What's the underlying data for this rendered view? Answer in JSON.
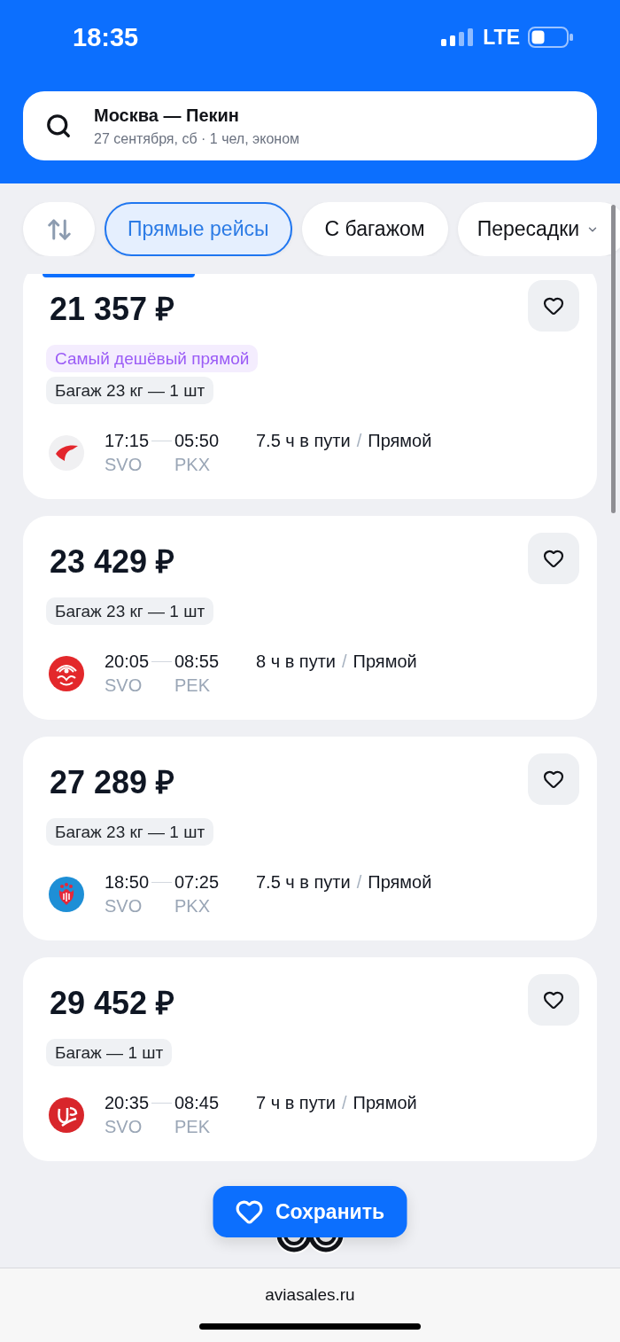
{
  "status_bar": {
    "time": "18:35",
    "network": "LTE"
  },
  "search": {
    "route": "Москва — Пекин",
    "details": "27 сентября, сб · 1 чел, эконом"
  },
  "filters": [
    {
      "kind": "sort",
      "selected": false
    },
    {
      "kind": "chip",
      "label": "Прямые рейсы",
      "selected": true
    },
    {
      "kind": "chip",
      "label": "С багажом",
      "selected": false
    },
    {
      "kind": "dropdown",
      "label": "Пересадки",
      "selected": false
    }
  ],
  "results": [
    {
      "top_tag": true,
      "price": "21 357 ₽",
      "saved": false,
      "badges": [
        {
          "kind": "highlight",
          "text": "Самый дешёвый прямой"
        },
        {
          "kind": "baggage",
          "text": "Багаж 23 кг — 1 шт"
        }
      ],
      "flight": {
        "departure_time": "17:15",
        "arrival_time": "05:50",
        "origin": "SVO",
        "destination": "PKX",
        "duration": "7.5 ч в пути",
        "separator": "/",
        "stops": "Прямой"
      }
    },
    {
      "top_tag": false,
      "price": "23 429 ₽",
      "saved": false,
      "badges": [
        {
          "kind": "baggage",
          "text": "Багаж 23 кг — 1 шт"
        }
      ],
      "flight": {
        "departure_time": "20:05",
        "arrival_time": "08:55",
        "origin": "SVO",
        "destination": "PEK",
        "duration": "8 ч в пути",
        "separator": "/",
        "stops": "Прямой"
      }
    },
    {
      "top_tag": false,
      "price": "27 289 ₽",
      "saved": false,
      "badges": [
        {
          "kind": "baggage",
          "text": "Багаж 23 кг — 1 шт"
        }
      ],
      "flight": {
        "departure_time": "18:50",
        "arrival_time": "07:25",
        "origin": "SVO",
        "destination": "PKX",
        "duration": "7.5 ч в пути",
        "separator": "/",
        "stops": "Прямой"
      }
    },
    {
      "top_tag": false,
      "price": "29 452 ₽",
      "saved": false,
      "badges": [
        {
          "kind": "baggage",
          "text": "Багаж — 1 шт"
        }
      ],
      "flight": {
        "departure_time": "20:35",
        "arrival_time": "08:45",
        "origin": "SVO",
        "destination": "PEK",
        "duration": "7 ч в пути",
        "separator": "/",
        "stops": "Прямой"
      }
    }
  ],
  "save_button": {
    "label": "Сохранить"
  },
  "browser": {
    "url": "aviasales.ru"
  }
}
